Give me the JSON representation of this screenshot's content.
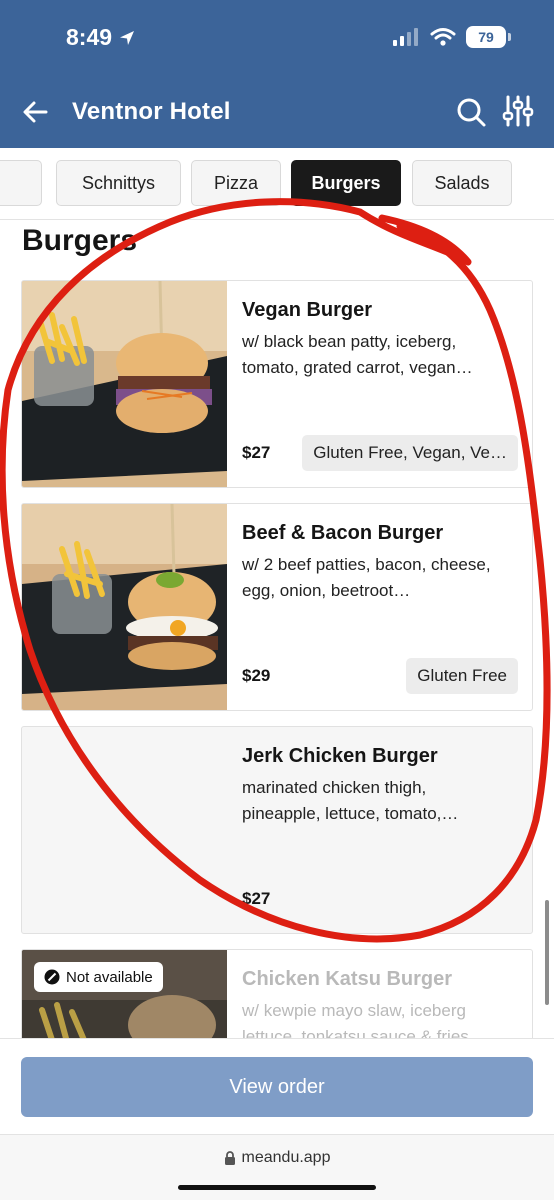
{
  "status_bar": {
    "time": "8:49",
    "battery": "79"
  },
  "header": {
    "title": "Ventnor Hotel"
  },
  "tabs": [
    {
      "label": ""
    },
    {
      "label": "Schnittys"
    },
    {
      "label": "Pizza"
    },
    {
      "label": "Burgers",
      "active": true
    },
    {
      "label": "Salads"
    }
  ],
  "section": {
    "title": "Burgers"
  },
  "items": [
    {
      "name": "Vegan Burger",
      "description": "w/ black bean patty, iceberg, tomato, grated carrot, vegan…",
      "price": "$27",
      "tags": "Gluten Free, Vegan, Ve…",
      "has_image": true,
      "available": true
    },
    {
      "name": "Beef & Bacon Burger",
      "description": "w/ 2 beef patties, bacon, cheese, egg, onion, beetroot…",
      "price": "$29",
      "tags": "Gluten Free",
      "has_image": true,
      "available": true
    },
    {
      "name": "Jerk Chicken Burger",
      "description": "marinated chicken thigh, pineapple, lettuce, tomato,…",
      "price": "$27",
      "tags": "",
      "has_image": false,
      "available": true
    },
    {
      "name": "Chicken Katsu Burger",
      "description": "w/ kewpie mayo slaw, iceberg lettuce, tonkatsu sauce & fries",
      "price": "",
      "tags": "",
      "has_image": true,
      "available": false,
      "badge": "Not available"
    }
  ],
  "footer": {
    "view_order": "View order"
  },
  "browser": {
    "url": "meandu.app"
  },
  "colors": {
    "header": "#3c6499",
    "button": "#7f9dc7",
    "active_tab": "#1a1a1a",
    "annotation": "#dd1f12"
  }
}
